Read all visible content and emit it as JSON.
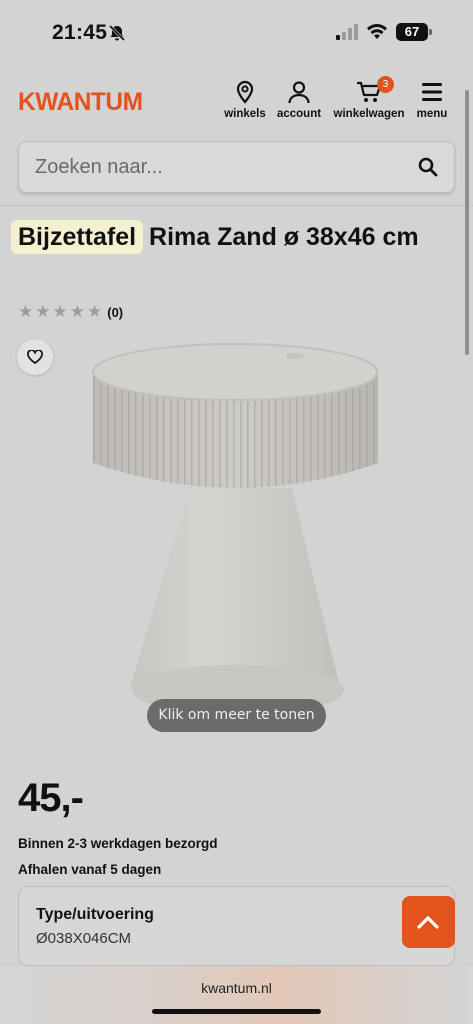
{
  "status_bar": {
    "time": "21:45",
    "battery": "67"
  },
  "header": {
    "logo": "KWANTUM",
    "nav": {
      "stores": "winkels",
      "account": "account",
      "cart": "winkelwagen",
      "cart_count": "3",
      "menu": "menu"
    }
  },
  "search": {
    "placeholder": "Zoeken naar..."
  },
  "product": {
    "title_highlight": "Bijzettafel",
    "title_rest": " Rima Zand ø 38x46 cm",
    "rating_stars": 0,
    "rating_count": "(0)",
    "image_hint": "Klik om meer te tonen",
    "price": "45,-",
    "delivery": "Binnen 2-3 werkdagen bezorgd",
    "pickup": "Afhalen vanaf 5 dagen",
    "variant_label": "Type/uitvoering",
    "variant_value": "Ø038X046CM"
  },
  "browser": {
    "url": "kwantum.nl"
  },
  "colors": {
    "brand": "#e2541b",
    "highlight": "#f5f0cf"
  }
}
